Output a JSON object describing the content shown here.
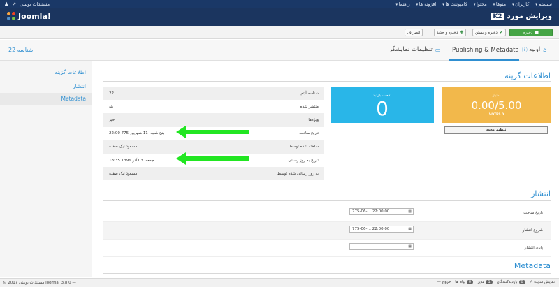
{
  "topbar": {
    "user_name": "مستندات یوبینی",
    "menu": [
      "سیستم",
      "کاربران",
      "منوها",
      "محتوا",
      "کامپوننت ها",
      "افزونه ها",
      "راهنما"
    ]
  },
  "header": {
    "logo_text": "Joomla!",
    "k2_badge": "K2",
    "page_title": "ویرایش مورد"
  },
  "toolbar": {
    "save": "ذخیره",
    "save_close": "ذخیره و بستن",
    "save_new": "ذخیره و جدید",
    "cancel": "انصراف"
  },
  "tabs": {
    "id_label": "شناسه 22",
    "items": [
      "اولیه",
      "Publishing & Metadata",
      "تنظیمات نمایشگر"
    ]
  },
  "sidebar": {
    "items": [
      "اطلاعات گزینه",
      "انتشار",
      "Metadata"
    ]
  },
  "main": {
    "section_info": "اطلاعات گزینه",
    "rating_card": {
      "caption": "امتیاز",
      "value": "0.00/5.00",
      "votes": "VOTES 0"
    },
    "votes_card": {
      "caption": "دفعات بازدید",
      "value": "0"
    },
    "reset_button": "تنظیم مجدد",
    "info_rows": [
      {
        "label": "شناسه آیتم",
        "value": "22"
      },
      {
        "label": "منتشر شده",
        "value": "بله"
      },
      {
        "label": "ویژه‌ها",
        "value": "خیر"
      },
      {
        "label": "تاریخ ساخت",
        "value": "پنج شنبه، 11 شهریور 775 22:00"
      },
      {
        "label": "ساخته شده توسط",
        "value": "مسعود نیک صفت"
      },
      {
        "label": "تاریخ به روز رسانی",
        "value": "جمعه، 03 آذر 1396 18:35"
      },
      {
        "label": "به روز رسانی شده توسط",
        "value": "مسعود نیک صفت"
      }
    ],
    "section_publish": "انتشار",
    "publish_rows": [
      {
        "label": "تاریخ ساخت",
        "value": "775-06-… 22:00:00"
      },
      {
        "label": "شروع انتشار",
        "value": "775-06-… 22:00:00"
      },
      {
        "label": "پایان انتشار",
        "value": ""
      }
    ],
    "section_meta": "Metadata"
  },
  "statusbar": {
    "copyright": "© 2017 مستندات یوبینی Joomla! 3.8.0 —",
    "view_site": "نمایش سایت",
    "visitors": "بازدیدکنندگان",
    "admin": "مدیر",
    "messages": "پیام ها",
    "logout": "خروج",
    "counts": [
      "0",
      "1",
      "0"
    ]
  },
  "colors": {
    "navy": "#1b355f",
    "accent_blue": "#2f8fd1",
    "rating_card": "#f2b84b",
    "votes_card": "#29b6e8",
    "save_green": "#46a546",
    "arrow_green": "#22e622"
  }
}
